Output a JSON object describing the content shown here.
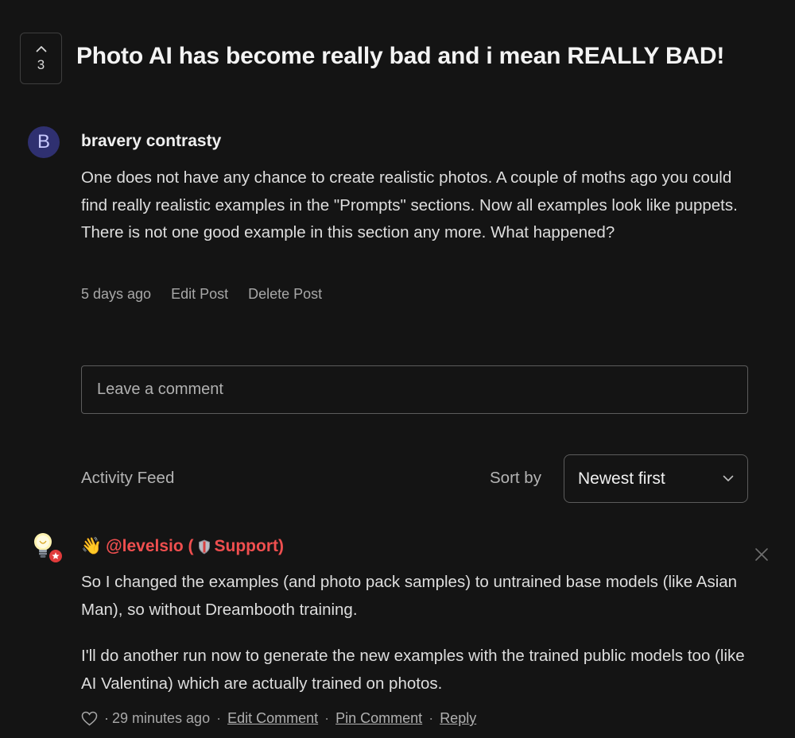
{
  "post": {
    "upvotes": "3",
    "title": "Photo AI has become really bad and i mean REALLY BAD!",
    "author_initial": "B",
    "author": "bravery contrasty",
    "body": "One does not have any chance to create realistic photos. A couple of moths ago you could find really realistic examples in the \"Prompts\" sections. Now all examples look like puppets. There is not one good example in this section any more. What happened?",
    "time": "5 days ago",
    "edit_label": "Edit Post",
    "delete_label": "Delete Post"
  },
  "comment_box": {
    "placeholder": "Leave a comment"
  },
  "feed": {
    "label": "Activity Feed",
    "sort_label": "Sort by",
    "sort_value": "Newest first"
  },
  "comment": {
    "wave_emoji": "👋",
    "author": "@levelsio (",
    "role": "Support)",
    "paragraphs": [
      "So I changed the examples (and photo pack samples) to untrained base models (like Asian Man), so without Dreambooth training.",
      "I'll do another run now to generate the new examples with the trained public models too (like AI Valentina) which are actually trained on photos."
    ],
    "time": "29 minutes ago",
    "edit_label": "Edit Comment",
    "pin_label": "Pin Comment",
    "reply_label": "Reply",
    "separator": "·"
  }
}
